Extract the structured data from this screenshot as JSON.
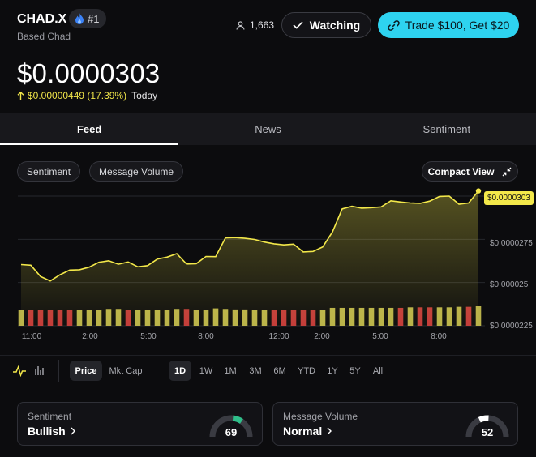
{
  "header": {
    "ticker": "CHAD.X",
    "rank": "#1",
    "name": "Based Chad",
    "watchers": "1,663",
    "watch_label": "Watching",
    "trade_label": "Trade $100, Get $20"
  },
  "price": {
    "value": "$0.0000303",
    "change": "$0.00000449 (17.39%)",
    "period": "Today"
  },
  "tabs": [
    {
      "label": "Feed",
      "active": true
    },
    {
      "label": "News",
      "active": false
    },
    {
      "label": "Sentiment",
      "active": false
    }
  ],
  "chips": {
    "sentiment": "Sentiment",
    "message_volume": "Message Volume",
    "compact_view": "Compact View"
  },
  "chart_data": {
    "type": "line",
    "current_label": "$0.0000303",
    "y_ticks": [
      "$0.0000275",
      "$0.000025",
      "$0.0000225"
    ],
    "x_ticks": [
      "11:00",
      "2:00",
      "5:00",
      "8:00",
      "12:00",
      "2:00",
      "5:00",
      "8:00"
    ],
    "ylim": [
      2.25e-05,
      3e-05
    ],
    "line_color": "#f3e84a",
    "values": [
      2.604e-05,
      2.6e-05,
      2.535e-05,
      2.509e-05,
      2.545e-05,
      2.572e-05,
      2.574e-05,
      2.589e-05,
      2.617e-05,
      2.626e-05,
      2.606e-05,
      2.619e-05,
      2.591e-05,
      2.598e-05,
      2.636e-05,
      2.647e-05,
      2.667e-05,
      2.607e-05,
      2.609e-05,
      2.651e-05,
      2.65e-05,
      2.758e-05,
      2.76e-05,
      2.756e-05,
      2.749e-05,
      2.734e-05,
      2.724e-05,
      2.718e-05,
      2.722e-05,
      2.677e-05,
      2.68e-05,
      2.706e-05,
      2.793e-05,
      2.926e-05,
      2.941e-05,
      2.93e-05,
      2.933e-05,
      2.937e-05,
      2.973e-05,
      2.966e-05,
      2.96e-05,
      2.958e-05,
      2.971e-05,
      2.998e-05,
      3e-05,
      2.953e-05,
      2.96e-05,
      3.03e-05
    ],
    "volume": [
      3,
      3,
      3,
      3,
      3,
      3,
      3,
      3,
      3,
      3.2,
      3.2,
      3,
      3,
      3,
      3,
      3,
      3.2,
      3.2,
      3,
      3,
      3.3,
      3.2,
      3.1,
      3.1,
      3,
      3,
      3,
      3,
      3,
      3,
      3,
      3,
      3.4,
      3.4,
      3.4,
      3.4,
      3.4,
      3.4,
      3.4,
      3.4,
      3.5,
      3.5,
      3.5,
      3.5,
      3.5,
      3.6,
      3.6,
      3.7
    ],
    "volume_colors": [
      "y",
      "r",
      "r",
      "r",
      "r",
      "r",
      "y",
      "y",
      "y",
      "y",
      "y",
      "r",
      "y",
      "y",
      "y",
      "y",
      "y",
      "r",
      "y",
      "y",
      "y",
      "y",
      "y",
      "y",
      "y",
      "y",
      "r",
      "r",
      "r",
      "r",
      "r",
      "y",
      "y",
      "y",
      "y",
      "y",
      "y",
      "y",
      "y",
      "r",
      "y",
      "r",
      "r",
      "y",
      "y",
      "y",
      "r",
      "y"
    ]
  },
  "controls": {
    "price": "Price",
    "mkt_cap": "Mkt Cap",
    "ranges": [
      "1D",
      "1W",
      "1M",
      "3M",
      "6M",
      "YTD",
      "1Y",
      "5Y",
      "All"
    ],
    "selected_range": "1D"
  },
  "cards": {
    "sentiment_title": "Sentiment",
    "sentiment_value": "Bullish",
    "sentiment_score": "69",
    "sentiment_level": 0.69,
    "volume_title": "Message Volume",
    "volume_value": "Normal",
    "volume_score": "52",
    "volume_level": 0.52
  },
  "colors": {
    "accent": "#2ed3f0",
    "up": "#f0e54a",
    "bullish": "#2fbf8a",
    "bar_up": "#b9b24a",
    "bar_down": "#c23a3a"
  }
}
